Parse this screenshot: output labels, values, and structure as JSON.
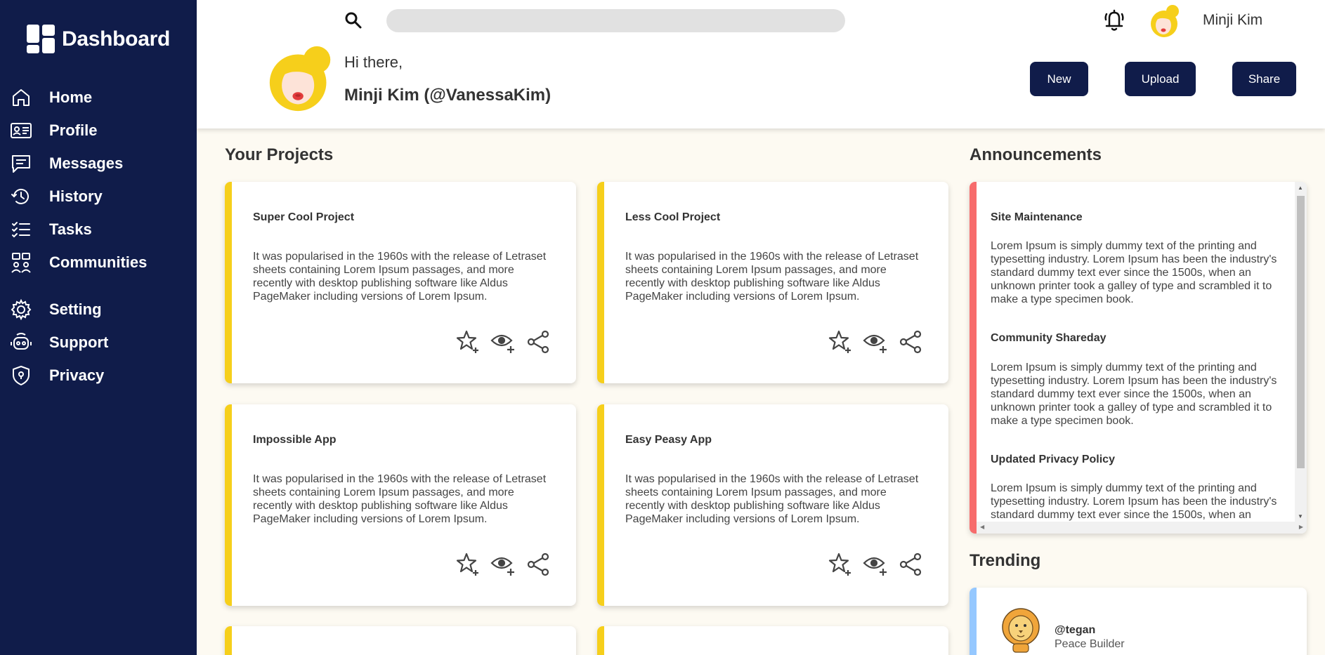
{
  "app": {
    "title": "Dashboard"
  },
  "sidebar": {
    "items": [
      {
        "label": "Home",
        "icon": "home-icon"
      },
      {
        "label": "Profile",
        "icon": "id-card-icon"
      },
      {
        "label": "Messages",
        "icon": "message-icon"
      },
      {
        "label": "History",
        "icon": "history-icon"
      },
      {
        "label": "Tasks",
        "icon": "checklist-icon"
      },
      {
        "label": "Communities",
        "icon": "community-icon"
      },
      {
        "label": "Setting",
        "icon": "gear-icon"
      },
      {
        "label": "Support",
        "icon": "support-icon"
      },
      {
        "label": "Privacy",
        "icon": "shield-icon"
      }
    ]
  },
  "header": {
    "search_placeholder": "",
    "user_name": "Minji Kim",
    "greeting": "Hi there,",
    "handle": "Minji Kim (@VanessaKim)",
    "buttons": {
      "new": "New",
      "upload": "Upload",
      "share": "Share"
    }
  },
  "projects": {
    "title": "Your Projects",
    "items": [
      {
        "title": "Super Cool Project",
        "desc": "It was popularised in the 1960s with the release of Letraset sheets containing Lorem Ipsum passages, and more recently with desktop publishing software like Aldus PageMaker including versions of Lorem Ipsum."
      },
      {
        "title": "Less Cool Project",
        "desc": "It was popularised in the 1960s with the release of Letraset sheets containing Lorem Ipsum passages, and more recently with desktop publishing software like Aldus PageMaker including versions of Lorem Ipsum."
      },
      {
        "title": "Impossible App",
        "desc": "It was popularised in the 1960s with the release of Letraset sheets containing Lorem Ipsum passages, and more recently with desktop publishing software like Aldus PageMaker including versions of Lorem Ipsum."
      },
      {
        "title": "Easy Peasy App",
        "desc": "It was popularised in the 1960s with the release of Letraset sheets containing Lorem Ipsum passages, and more recently with desktop publishing software like Aldus PageMaker including versions of Lorem Ipsum."
      }
    ]
  },
  "announcements": {
    "title": "Announcements",
    "items": [
      {
        "title": "Site Maintenance",
        "text": "Lorem Ipsum is simply dummy text of the printing and typesetting industry. Lorem Ipsum has been the industry's standard dummy text ever since the 1500s, when an unknown printer took a galley of type and scrambled it to make a type specimen book."
      },
      {
        "title": "Community Shareday",
        "text": "Lorem Ipsum is simply dummy text of the printing and typesetting industry. Lorem Ipsum has been the industry's standard dummy text ever since the 1500s, when an unknown printer took a galley of type and scrambled it to make a type specimen book."
      },
      {
        "title": "Updated Privacy Policy",
        "text": "Lorem Ipsum is simply dummy text of the printing and typesetting industry. Lorem Ipsum has been the industry's standard dummy text ever since the 1500s, when an unknown printer took a galley of type and scrambled it to make a type specimen book."
      }
    ]
  },
  "trending": {
    "title": "Trending",
    "items": [
      {
        "handle": "@tegan",
        "role": "Peace Builder"
      }
    ]
  },
  "colors": {
    "sidebar": "#101c4a",
    "project_accent": "#f6cf1b",
    "announcement_accent": "#f76c6c",
    "trending_accent": "#95c8ff",
    "background": "#fdfaf2"
  }
}
